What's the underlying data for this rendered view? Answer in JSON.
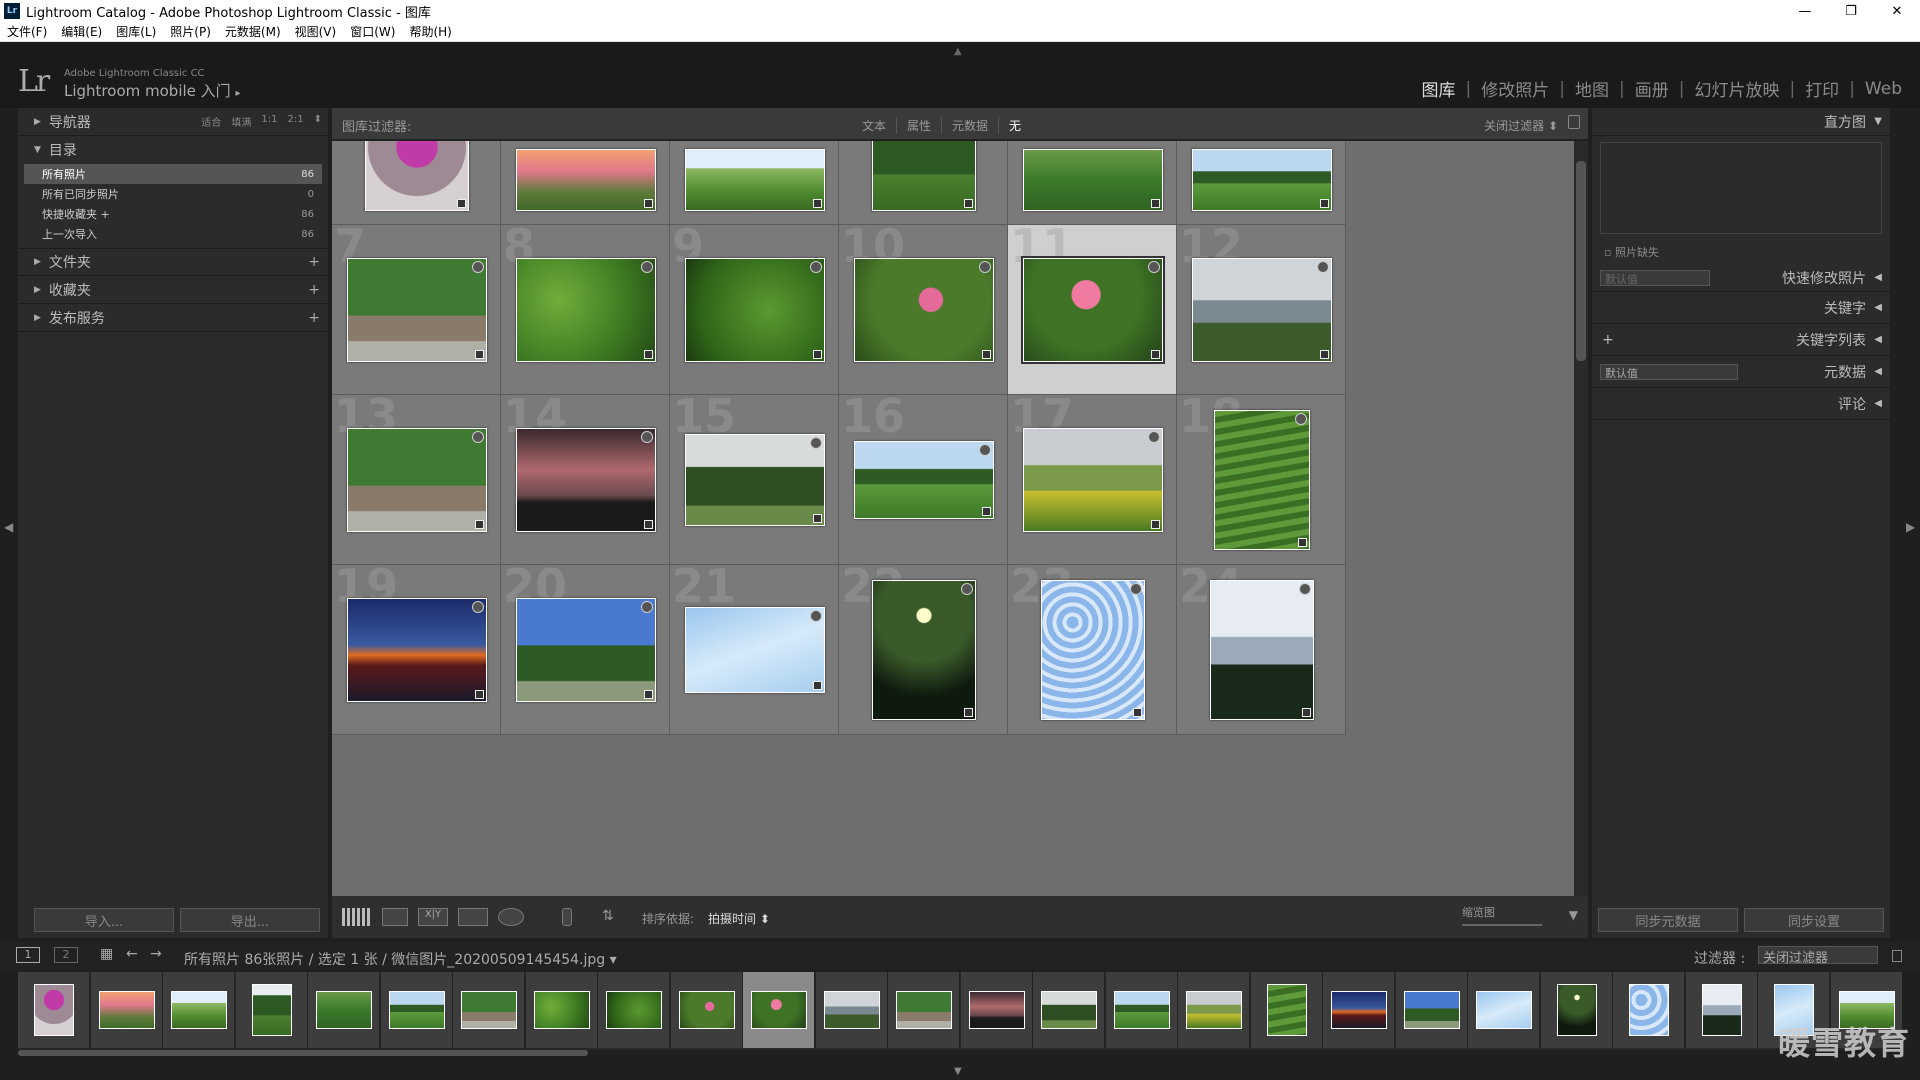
{
  "window": {
    "icon": "Lr",
    "title": "Lightroom Catalog - Adobe Photoshop Lightroom Classic - 图库",
    "min": "—",
    "max": "❐",
    "close": "✕"
  },
  "menu": [
    "文件(F)",
    "编辑(E)",
    "图库(L)",
    "照片(P)",
    "元数据(M)",
    "视图(V)",
    "窗口(W)",
    "帮助(H)"
  ],
  "identity": {
    "logo": "Lr",
    "line1": "Adobe Lightroom Classic CC",
    "line2": "Lightroom mobile 入门",
    "arrow": "▸"
  },
  "modules": [
    {
      "label": "图库",
      "active": true
    },
    {
      "label": "修改照片"
    },
    {
      "label": "地图"
    },
    {
      "label": "画册"
    },
    {
      "label": "幻灯片放映"
    },
    {
      "label": "打印"
    },
    {
      "label": "Web"
    }
  ],
  "left": {
    "navigator": {
      "label": "导航器",
      "opts": [
        "适合",
        "填满",
        "1:1",
        "2:1"
      ]
    },
    "catalog": {
      "label": "目录",
      "items": [
        {
          "label": "所有照片",
          "count": "86",
          "selected": true
        },
        {
          "label": "所有已同步照片",
          "count": "0"
        },
        {
          "label": "快捷收藏夹 +",
          "count": "86"
        },
        {
          "label": "上一次导入",
          "count": "86"
        }
      ]
    },
    "folders": "文件夹",
    "collections": "收藏夹",
    "publish": "发布服务",
    "import": "导入...",
    "export": "导出..."
  },
  "filter": {
    "label": "图库过滤器:",
    "options": [
      "文本",
      "属性",
      "元数据",
      "无"
    ],
    "off": "关闭过滤器 ⬍"
  },
  "toolbar": {
    "sort_label": "排序依据:",
    "sort_value": "拍摄时间 ⬍",
    "zoom_label": "缩览图"
  },
  "right": {
    "histogram": "直方图",
    "missing": "照片缺失",
    "quick": "快速修改照片",
    "quick_preset": "默认值",
    "keywording": "关键字",
    "keyword_list": "关键字列表",
    "metadata_preset": "默认值",
    "metadata": "元数据",
    "comments": "评论",
    "sync_meta": "同步元数据",
    "sync_settings": "同步设置"
  },
  "filmstrip": {
    "crumb": "所有照片   86张照片 / 选定 1 张 / 微信图片_20200509145454.jpg ▾",
    "filter_label": "过滤器 :",
    "filter_value": "关闭过滤器"
  },
  "grid_numbers": [
    "7",
    "8",
    "9",
    "10",
    "11",
    "12",
    "13",
    "14",
    "15",
    "16",
    "17",
    "18",
    "19",
    "20",
    "21",
    "22",
    "23",
    "24"
  ],
  "watermark": "暖雪教育",
  "colors": {
    "selected_cell": "#cfcfcf",
    "cell": "#7a7a7a",
    "active_module": "#dddddd"
  }
}
